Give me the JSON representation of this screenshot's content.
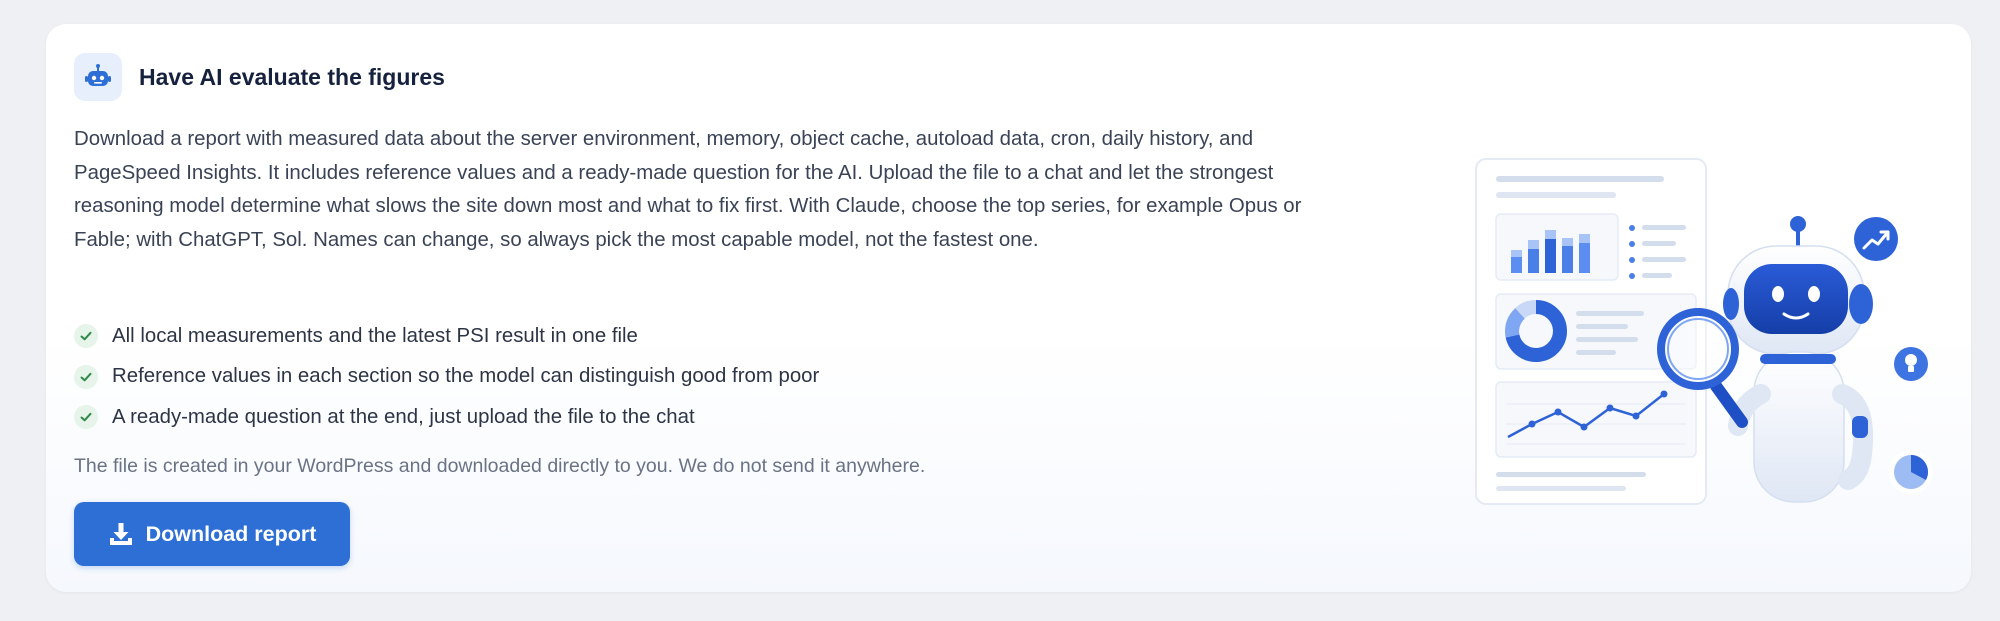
{
  "panel": {
    "title": "Have AI evaluate the figures",
    "header_icon": "robot-icon",
    "description": "Download a report with measured data about the server environment, memory, object cache, autoload data, cron, daily history, and PageSpeed Insights. It includes reference values and a ready-made question for the AI. Upload the file to a chat and let the strongest reasoning model determine what slows the site down most and what to fix first. With Claude, choose the top series, for example Opus or Fable; with ChatGPT, Sol. Names can change, so always pick the most capable model, not the fastest one.",
    "features": [
      {
        "icon": "check-icon",
        "text": "All local measurements and the latest PSI result in one file"
      },
      {
        "icon": "check-icon",
        "text": "Reference values in each section so the model can distinguish good from poor"
      },
      {
        "icon": "check-icon",
        "text": "A ready-made question at the end, just upload the file to the chat"
      }
    ],
    "note": "The file is created in your WordPress and downloaded directly to you. We do not send it anywhere.",
    "download_button": {
      "label": "Download report",
      "icon": "download-icon"
    },
    "illustration": "robot-analyzing-report-illustration"
  },
  "colors": {
    "accent": "#2e6fd6",
    "title": "#16213e",
    "text": "#3a4356",
    "muted": "#6a7385",
    "check": "#2f8a4a",
    "check_bg": "#e6f4ea",
    "icon_bg": "#e8effc"
  }
}
